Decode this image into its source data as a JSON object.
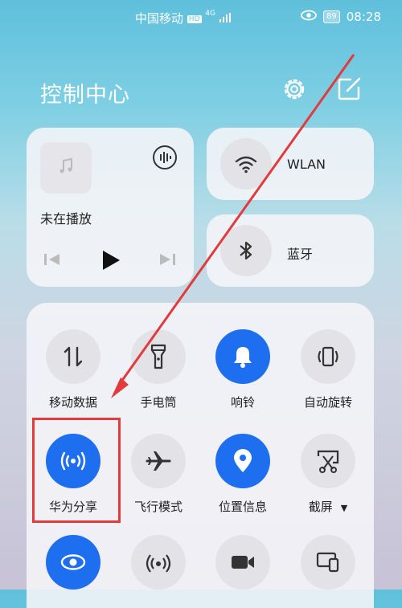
{
  "status": {
    "carrier": "中国移动",
    "hd": "HD",
    "signal_type": "4G",
    "battery": "89",
    "time": "08:28"
  },
  "header": {
    "title": "控制中心",
    "settings_icon": "gear-icon",
    "edit_icon": "edit-icon"
  },
  "media": {
    "status": "未在播放"
  },
  "quick": {
    "wlan": "WLAN",
    "bluetooth": "蓝牙"
  },
  "toggles": [
    {
      "label": "移动数据",
      "icon": "mobile-data-icon",
      "active": false
    },
    {
      "label": "手电筒",
      "icon": "flashlight-icon",
      "active": false
    },
    {
      "label": "响铃",
      "icon": "bell-icon",
      "active": true
    },
    {
      "label": "自动旋转",
      "icon": "auto-rotate-icon",
      "active": false
    },
    {
      "label": "华为分享",
      "icon": "huawei-share-icon",
      "active": true
    },
    {
      "label": "飞行模式",
      "icon": "airplane-icon",
      "active": false
    },
    {
      "label": "位置信息",
      "icon": "location-icon",
      "active": true
    },
    {
      "label": "截屏",
      "icon": "screenshot-icon",
      "active": false
    }
  ],
  "colors": {
    "accent": "#1e6ff0",
    "annotation": "#e23b3b"
  }
}
